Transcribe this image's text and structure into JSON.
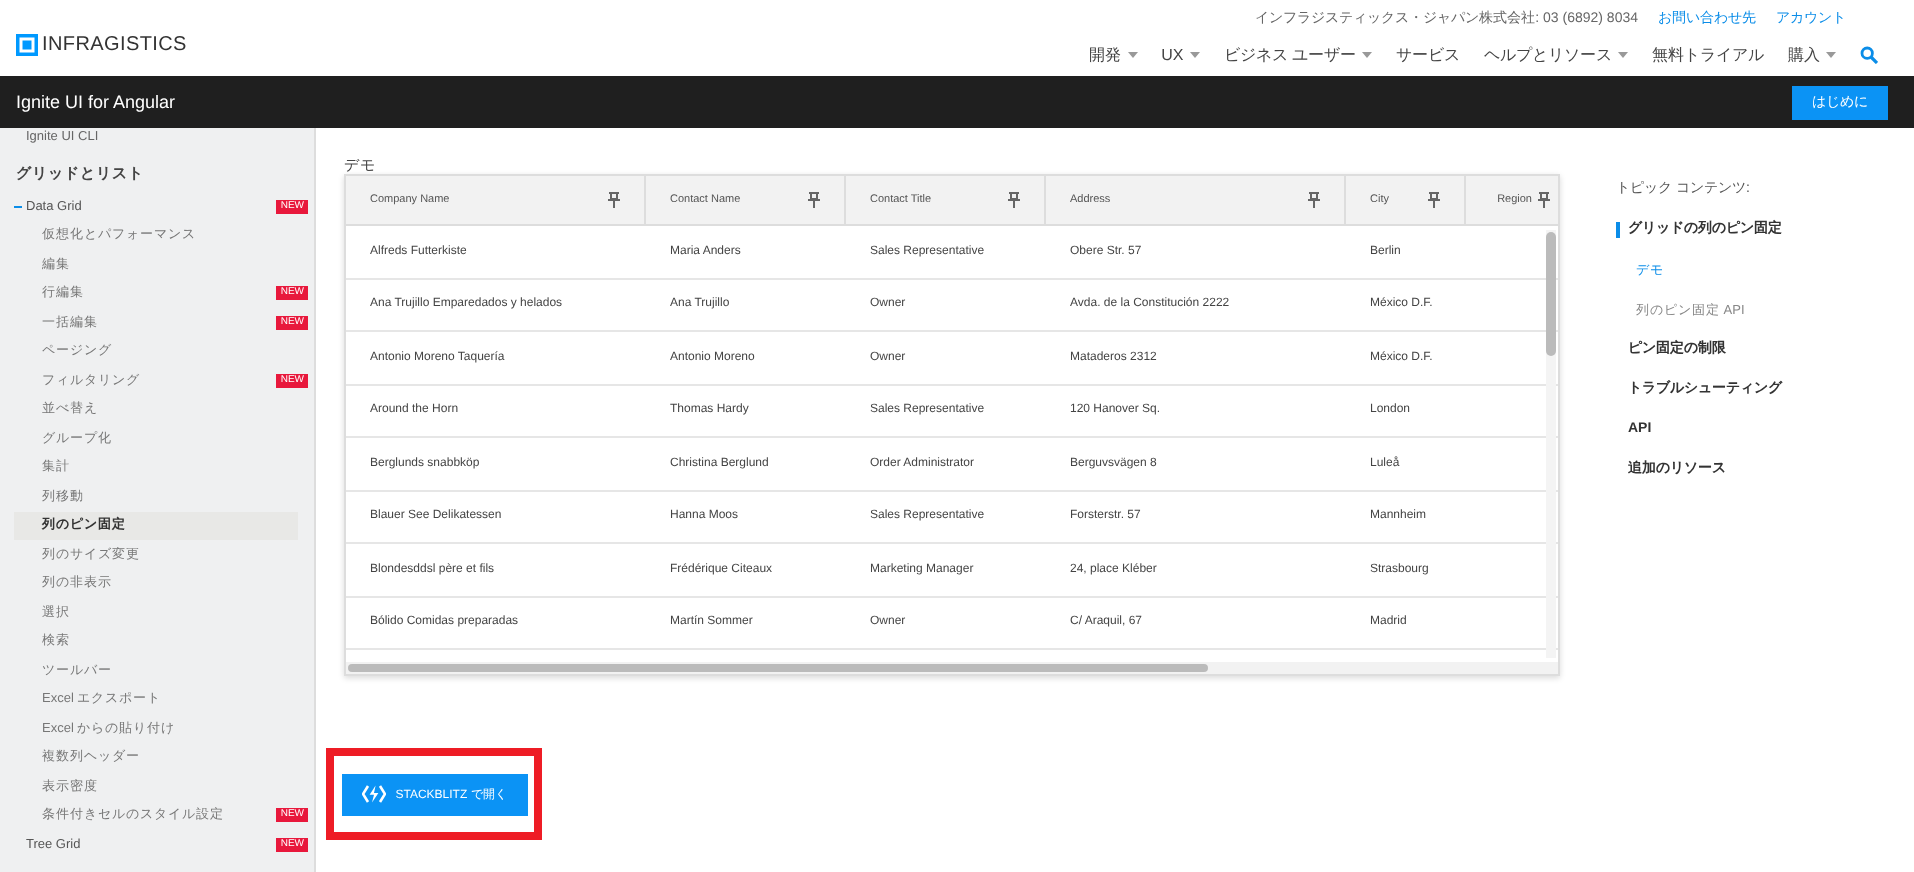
{
  "topbar": {
    "company": "インフラジスティックス・ジャパン株式会社: 03 (6892) 8034",
    "links": [
      "お問い合わせ先",
      "アカウント"
    ],
    "logo": "INFRAGISTICS"
  },
  "nav": [
    {
      "label": "開発",
      "dropdown": true
    },
    {
      "label": "UX",
      "dropdown": true
    },
    {
      "label": "ビジネス ユーザー",
      "dropdown": true
    },
    {
      "label": "サービス",
      "dropdown": false
    },
    {
      "label": "ヘルプとリソース",
      "dropdown": true
    },
    {
      "label": "無料トライアル",
      "dropdown": false
    },
    {
      "label": "購入",
      "dropdown": true
    }
  ],
  "product_bar": {
    "title": "Ignite UI for Angular",
    "button": "はじめに"
  },
  "sidebar": {
    "cut_item": "Ignite UI CLI",
    "heading": "グリッドとリスト",
    "items": [
      {
        "label": "Data Grid",
        "badge": "NEW",
        "expanded": true,
        "selected": false,
        "children": [
          {
            "label": "仮想化とパフォーマンス",
            "selected": false
          },
          {
            "label": "編集",
            "selected": false
          },
          {
            "label": "行編集",
            "badge": "NEW",
            "selected": false
          },
          {
            "label": "一括編集",
            "badge": "NEW",
            "selected": false
          },
          {
            "label": "ページング",
            "selected": false
          },
          {
            "label": "フィルタリング",
            "badge": "NEW",
            "selected": false
          },
          {
            "label": "並べ替え",
            "selected": false
          },
          {
            "label": "グループ化",
            "selected": false
          },
          {
            "label": "集計",
            "selected": false
          },
          {
            "label": "列移動",
            "selected": false
          },
          {
            "label": "列のピン固定",
            "selected": true
          },
          {
            "label": "列のサイズ変更",
            "selected": false
          },
          {
            "label": "列の非表示",
            "selected": false
          },
          {
            "label": "選択",
            "selected": false
          },
          {
            "label": "検索",
            "selected": false
          },
          {
            "label": "ツールバー",
            "selected": false
          },
          {
            "label": "Excel エクスポート",
            "selected": false
          },
          {
            "label": "Excel からの貼り付け",
            "selected": false
          },
          {
            "label": "複数列ヘッダー",
            "selected": false
          },
          {
            "label": "表示密度",
            "selected": false
          },
          {
            "label": "条件付きセルのスタイル設定",
            "badge": "NEW",
            "selected": false
          }
        ]
      },
      {
        "label": "Tree Grid",
        "badge": "NEW",
        "expanded": false,
        "selected": false
      }
    ]
  },
  "demo": {
    "title": "デモ",
    "button": "STACKBLITZ で開く"
  },
  "table": {
    "columns": [
      "Company Name",
      "Contact Name",
      "Contact Title",
      "Address",
      "City",
      "Region"
    ],
    "rows": [
      [
        "Alfreds Futterkiste",
        "Maria Anders",
        "Sales Representative",
        "Obere Str. 57",
        "Berlin"
      ],
      [
        "Ana Trujillo Emparedados y helados",
        "Ana Trujillo",
        "Owner",
        "Avda. de la Constitución 2222",
        "México D.F."
      ],
      [
        "Antonio Moreno Taquería",
        "Antonio Moreno",
        "Owner",
        "Mataderos 2312",
        "México D.F."
      ],
      [
        "Around the Horn",
        "Thomas Hardy",
        "Sales Representative",
        "120 Hanover Sq.",
        "London"
      ],
      [
        "Berglunds snabbköp",
        "Christina Berglund",
        "Order Administrator",
        "Berguvsvägen 8",
        "Luleå"
      ],
      [
        "Blauer See Delikatessen",
        "Hanna Moos",
        "Sales Representative",
        "Forsterstr. 57",
        "Mannheim"
      ],
      [
        "Blondesddsl père et fils",
        "Frédérique Citeaux",
        "Marketing Manager",
        "24, place Kléber",
        "Strasbourg"
      ],
      [
        "Bólido Comidas preparadas",
        "Martín Sommer",
        "Owner",
        "C/ Araquil, 67",
        "Madrid"
      ]
    ]
  },
  "toc": {
    "title": "トピック コンテンツ:",
    "items": [
      {
        "label": "グリッドの列のピン固定",
        "selected": true,
        "children": [
          {
            "label": "デモ",
            "selected": true
          },
          {
            "label": "列のピン固定 API",
            "selected": false
          }
        ]
      },
      {
        "label": "ピン固定の制限",
        "selected": false
      },
      {
        "label": "トラブルシューティング",
        "selected": false
      },
      {
        "label": "API",
        "selected": false
      },
      {
        "label": "追加のリソース",
        "selected": false
      }
    ]
  }
}
